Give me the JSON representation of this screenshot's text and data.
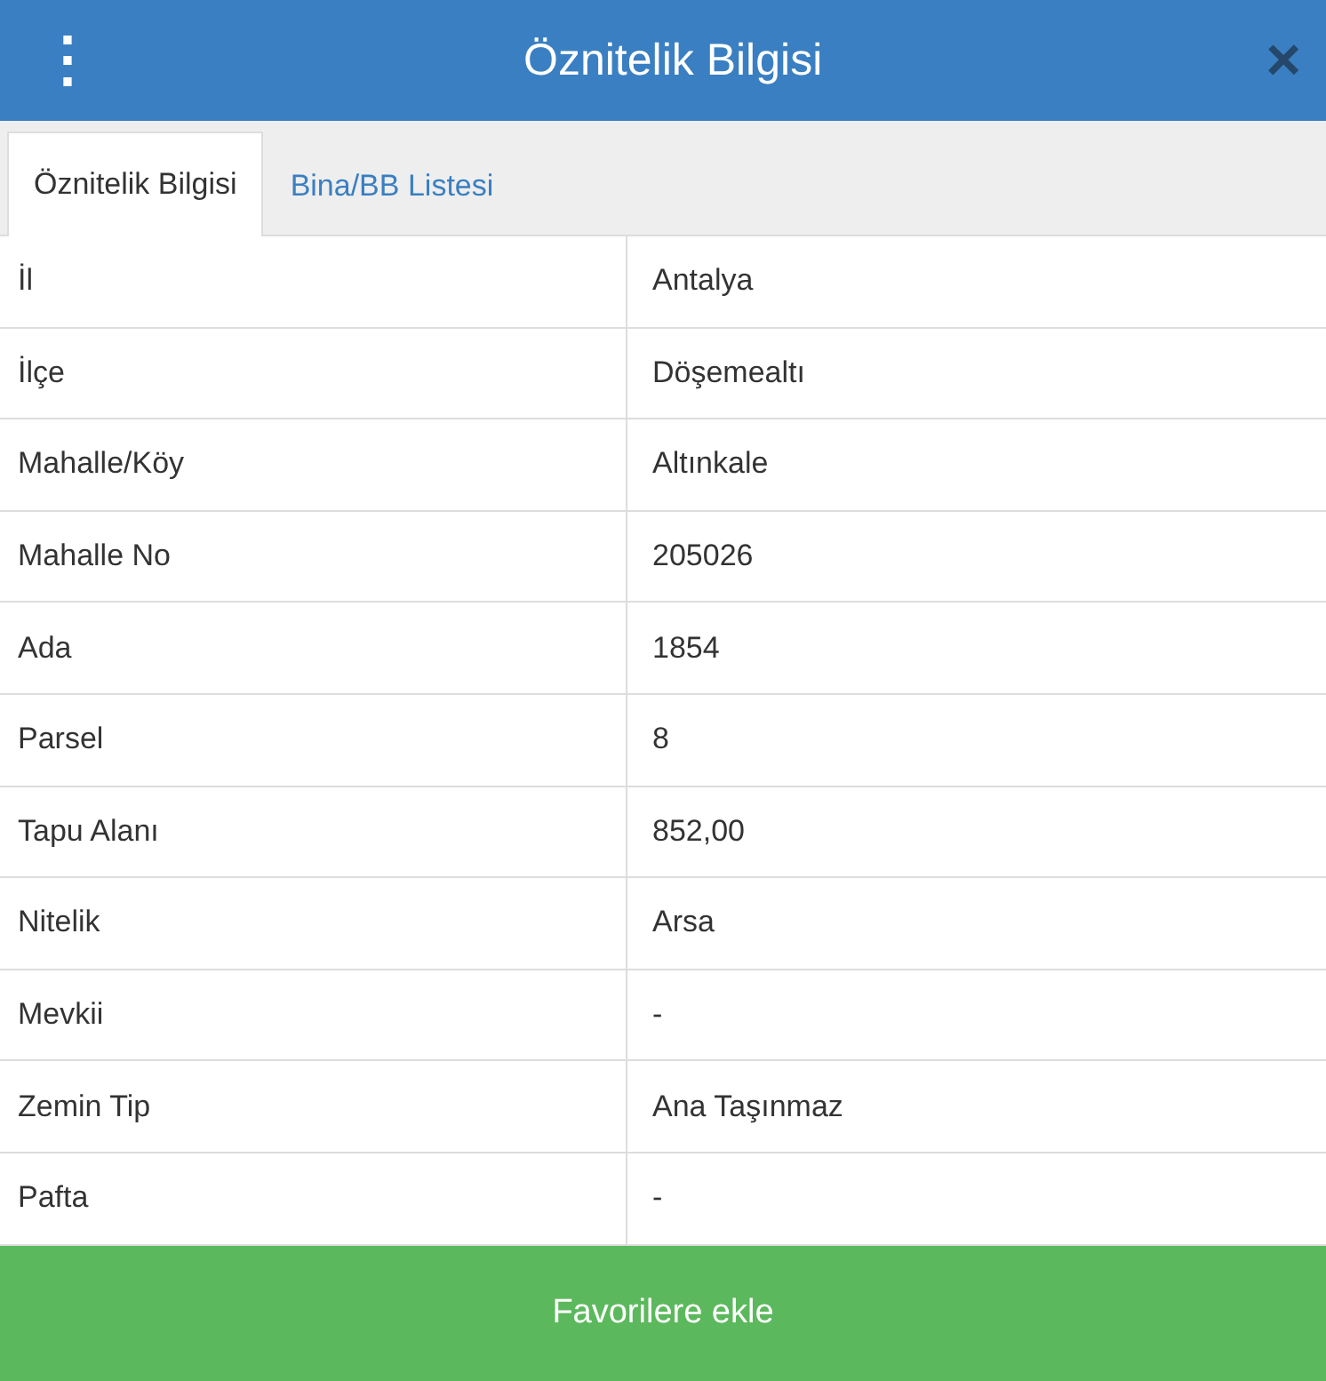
{
  "header": {
    "menu_icon": "⋮",
    "title": "Öznitelik Bilgisi",
    "close_icon": "×"
  },
  "tabs": [
    {
      "label": "Öznitelik Bilgisi",
      "selected": true
    },
    {
      "label": "Bina/BB Listesi",
      "selected": false
    }
  ],
  "table": {
    "rows": [
      {
        "label": "İl",
        "value": "Antalya"
      },
      {
        "label": "İlçe",
        "value": "Döşemealtı"
      },
      {
        "label": "Mahalle/Köy",
        "value": "Altınkale"
      },
      {
        "label": "Mahalle No",
        "value": "205026"
      },
      {
        "label": "Ada",
        "value": "1854"
      },
      {
        "label": "Parsel",
        "value": "8"
      },
      {
        "label": "Tapu Alanı",
        "value": "852,00"
      },
      {
        "label": "Nitelik",
        "value": "Arsa"
      },
      {
        "label": "Mevkii",
        "value": "-"
      },
      {
        "label": "Zemin Tip",
        "value": "Ana Taşınmaz"
      },
      {
        "label": "Pafta",
        "value": "-"
      }
    ]
  },
  "button": {
    "label": "Favorilere ekle"
  }
}
